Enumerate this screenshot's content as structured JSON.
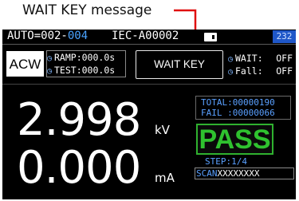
{
  "callout": {
    "label": "WAIT KEY message"
  },
  "status": {
    "auto_prefix": "AUTO=002-",
    "auto_step": "004",
    "test_name": "IEC-A00002",
    "badge": "232"
  },
  "mode": {
    "label": "ACW"
  },
  "params_left": [
    {
      "icon": "clock-icon",
      "label": "RAMP",
      "value": ":000.0s"
    },
    {
      "icon": "clock-icon",
      "label": "TEST",
      "value": ":000.0s"
    }
  ],
  "wait_key_message": "WAIT KEY",
  "params_right": [
    {
      "icon": "clock-icon",
      "label": "WAIT",
      "value": "OFF"
    },
    {
      "icon": "clock-icon",
      "label": "Fall",
      "value": "OFF"
    }
  ],
  "readings": {
    "voltage": "2.998",
    "voltage_unit": "kV",
    "current": "0.000",
    "current_unit": "mA"
  },
  "counts": {
    "total": "TOTAL:00000190",
    "fail": "FAIL :00000066"
  },
  "result": "PASS",
  "step": "STEP:1/4",
  "scan": {
    "label": "SCAN",
    "value": "XXXXXXXX"
  },
  "colors": {
    "screen_bg": "#000000",
    "accent_blue": "#5aa0ff",
    "pass_green": "#2fc22f",
    "badge_blue": "#1f57c8"
  }
}
